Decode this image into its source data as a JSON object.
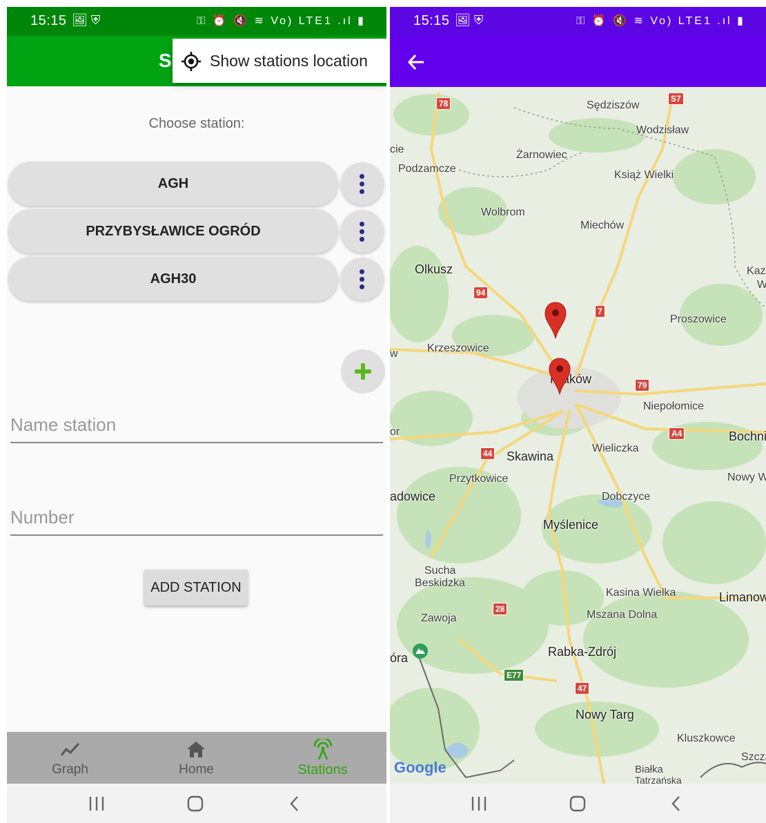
{
  "status_bar": {
    "time": "15:15",
    "left_icons": "🖼 ⛨",
    "right_icons": "⚿ ⏰ 🔇 ≋ Vo) LTE1 .ıl ▮"
  },
  "left_screen": {
    "app_title_fragment": "S",
    "overflow_menu": {
      "item_label": "Show stations location",
      "icon": "location-target-icon"
    },
    "choose_label": "Choose station:",
    "stations": [
      {
        "name": "AGH"
      },
      {
        "name": "PRZYBYSŁAWICE OGRÓD"
      },
      {
        "name": "AGH30"
      }
    ],
    "add_fab_icon": "plus-icon",
    "name_field": {
      "placeholder": "Name station",
      "value": ""
    },
    "number_field": {
      "placeholder": "Number",
      "value": ""
    },
    "add_button_label": "ADD STATION",
    "bottom_nav": [
      {
        "label": "Graph",
        "icon": "chart-line-icon",
        "active": false
      },
      {
        "label": "Home",
        "icon": "home-icon",
        "active": false
      },
      {
        "label": "Stations",
        "icon": "antenna-icon",
        "active": true
      }
    ],
    "colors": {
      "status_bar": "#00870a",
      "app_bar": "#00a312",
      "active_nav": "#2fa50f"
    }
  },
  "right_screen": {
    "back_icon": "arrow-back-icon",
    "colors": {
      "status_bar": "#5b06e3",
      "app_bar": "#6200ee",
      "marker": "#d93025"
    },
    "map": {
      "places": [
        "Sędziszów",
        "Wodzisław",
        "cie",
        "Żarnowiec",
        "Podzamcze",
        "Książ Wielki",
        "Wolbrom",
        "Miechów",
        "Olkusz",
        "Kaz",
        "W",
        "Proszowice",
        "Krzeszowice",
        "w",
        "Kraków",
        "Niepołomice",
        "or",
        "Bochni",
        "Wieliczka",
        "Skawina",
        "Przytkowice",
        "Nowy W",
        "adowice",
        "Dobczyce",
        "Myślenice",
        "Sucha",
        "Beskidzka",
        "Kasina Wielka",
        "Limanow",
        "Zawoja",
        "Mszana Dolna",
        "óra",
        "Rabka-Zdrój",
        "Nowy Targ",
        "Kluszkowce",
        "Szcza",
        "Białka",
        "Tatrzańska"
      ],
      "road_shields": [
        "78",
        "S7",
        "94",
        "7",
        "79",
        "A4",
        "44",
        "28",
        "E77",
        "47"
      ],
      "markers": [
        {
          "name": "station-marker-1"
        },
        {
          "name": "station-marker-2"
        }
      ],
      "attribution": "Google"
    }
  }
}
